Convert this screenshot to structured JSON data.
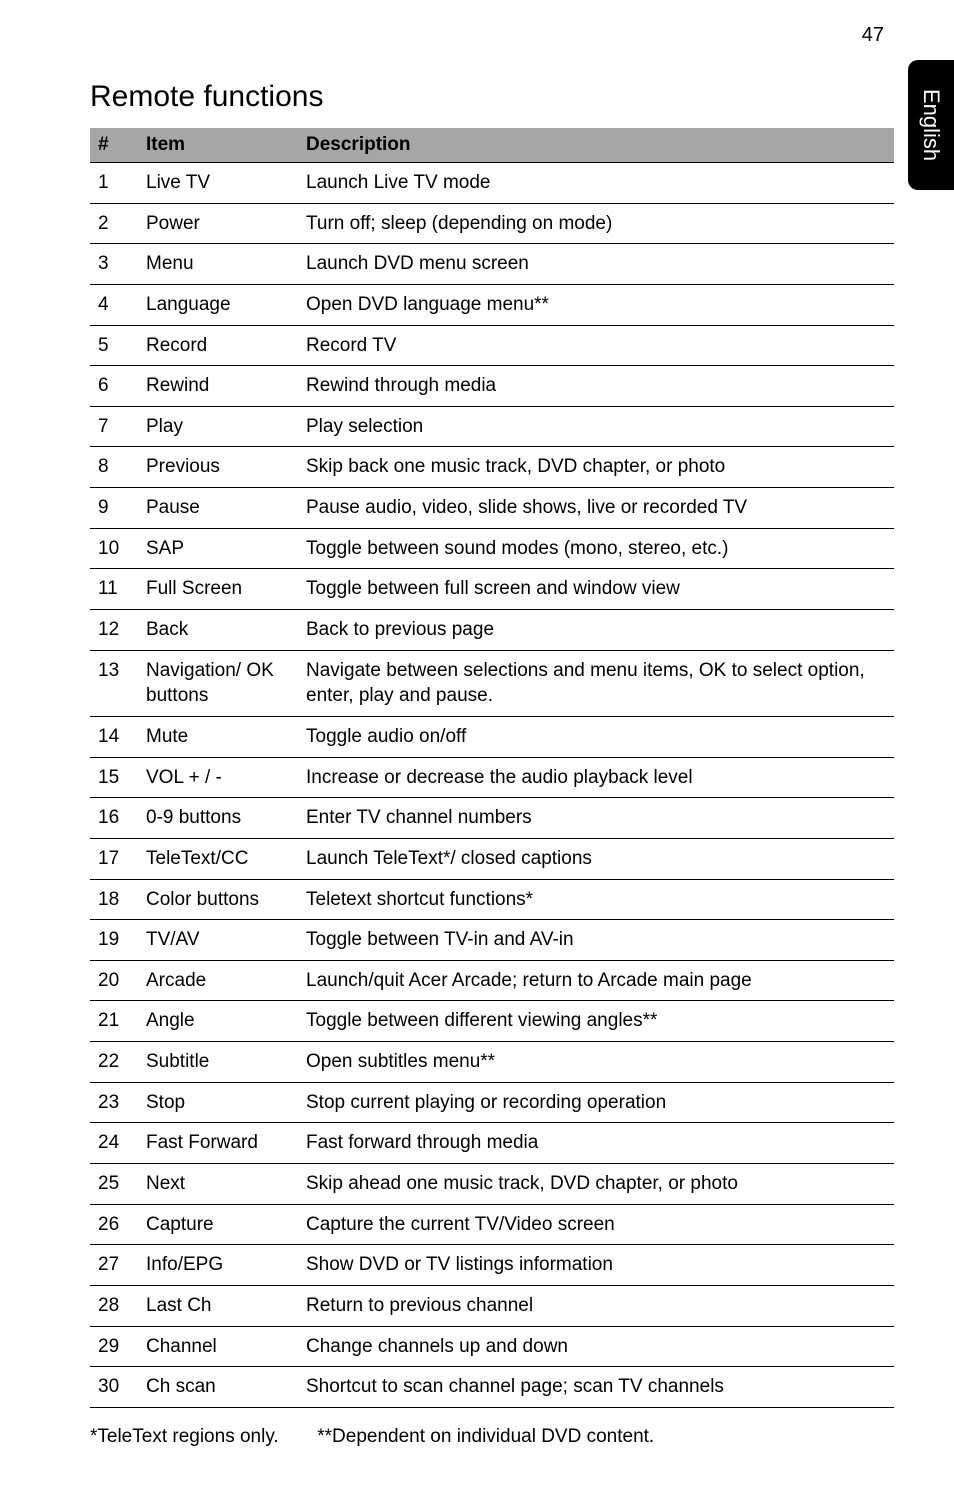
{
  "page_number": "47",
  "side_tab": "English",
  "title": "Remote functions",
  "headers": {
    "num": "#",
    "item": "Item",
    "desc": "Description"
  },
  "rows": [
    {
      "num": "1",
      "item": "Live TV",
      "desc": "Launch Live TV mode"
    },
    {
      "num": "2",
      "item": "Power",
      "desc": "Turn off; sleep (depending on mode)"
    },
    {
      "num": "3",
      "item": "Menu",
      "desc": "Launch DVD menu screen"
    },
    {
      "num": "4",
      "item": "Language",
      "desc": "Open DVD language menu**"
    },
    {
      "num": "5",
      "item": "Record",
      "desc": "Record TV"
    },
    {
      "num": "6",
      "item": "Rewind",
      "desc": "Rewind through media"
    },
    {
      "num": "7",
      "item": "Play",
      "desc": "Play selection"
    },
    {
      "num": "8",
      "item": "Previous",
      "desc": "Skip back one music track, DVD chapter, or photo"
    },
    {
      "num": "9",
      "item": "Pause",
      "desc": "Pause audio, video, slide shows, live or recorded TV"
    },
    {
      "num": "10",
      "item": "SAP",
      "desc": "Toggle between sound modes (mono, stereo, etc.)"
    },
    {
      "num": "11",
      "item": "Full Screen",
      "desc": "Toggle between full screen and window view"
    },
    {
      "num": "12",
      "item": "Back",
      "desc": "Back to previous page"
    },
    {
      "num": "13",
      "item": "Navigation/ OK buttons",
      "desc": "Navigate between selections and menu items, OK to select option, enter, play and pause."
    },
    {
      "num": "14",
      "item": "Mute",
      "desc": "Toggle audio on/off"
    },
    {
      "num": "15",
      "item": "VOL + / -",
      "desc": "Increase or decrease the audio playback level"
    },
    {
      "num": "16",
      "item": "0-9 buttons",
      "desc": "Enter TV channel numbers"
    },
    {
      "num": "17",
      "item": "TeleText/CC",
      "desc": "Launch TeleText*/ closed captions"
    },
    {
      "num": "18",
      "item": "Color buttons",
      "desc": "Teletext shortcut functions*"
    },
    {
      "num": "19",
      "item": "TV/AV",
      "desc": "Toggle between TV-in and AV-in"
    },
    {
      "num": "20",
      "item": "Arcade",
      "desc": "Launch/quit Acer Arcade; return to Arcade main page"
    },
    {
      "num": "21",
      "item": "Angle",
      "desc": "Toggle between different viewing angles**"
    },
    {
      "num": "22",
      "item": "Subtitle",
      "desc": "Open subtitles menu**"
    },
    {
      "num": "23",
      "item": "Stop",
      "desc": "Stop current playing or recording operation"
    },
    {
      "num": "24",
      "item": "Fast Forward",
      "desc": "Fast forward through media"
    },
    {
      "num": "25",
      "item": "Next",
      "desc": "Skip ahead one music track, DVD chapter, or photo"
    },
    {
      "num": "26",
      "item": "Capture",
      "desc": "Capture the current TV/Video screen"
    },
    {
      "num": "27",
      "item": "Info/EPG",
      "desc": "Show DVD or TV listings information"
    },
    {
      "num": "28",
      "item": "Last Ch",
      "desc": "Return to previous channel"
    },
    {
      "num": "29",
      "item": "Channel",
      "desc": "Change channels up and down"
    },
    {
      "num": "30",
      "item": "Ch scan",
      "desc": "Shortcut to scan channel page; scan TV channels"
    }
  ],
  "footnote": {
    "a": "*TeleText regions only.",
    "b": "**Dependent on individual DVD content."
  }
}
